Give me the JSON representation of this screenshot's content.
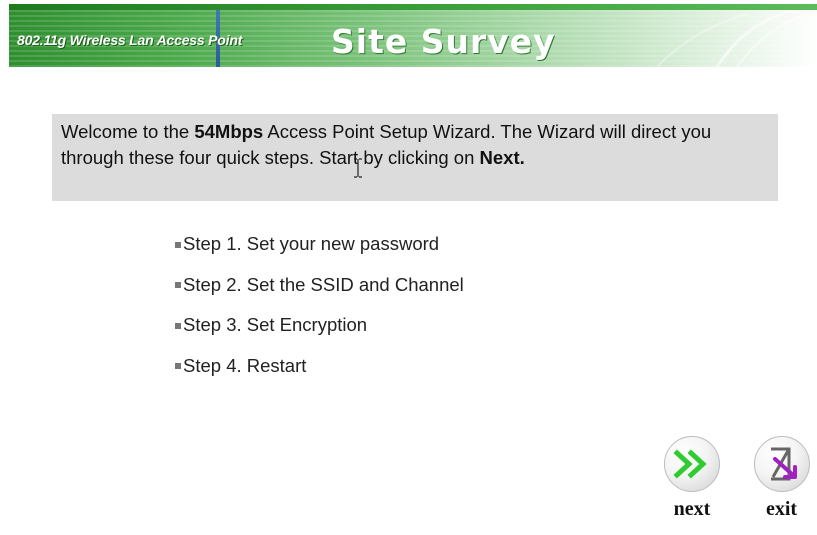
{
  "header": {
    "product_name": "802.11g Wireless Lan Access Point",
    "page_title": "Site Survey"
  },
  "welcome": {
    "text_before_bold": "Welcome to the ",
    "bold_speed": "54Mbps",
    "text_after_bold": " Access Point Setup Wizard. The Wizard will direct you through these four quick steps. Start by clicking on ",
    "bold_next": "Next."
  },
  "steps": [
    {
      "label": "Step 1. Set your new password"
    },
    {
      "label": "Step 2. Set the SSID and Channel"
    },
    {
      "label": "Step 3. Set Encryption"
    },
    {
      "label": "Step 4. Restart"
    }
  ],
  "nav": {
    "next_label": "next",
    "exit_label": "exit"
  },
  "colors": {
    "header_green": "#2f8f2f",
    "welcome_bg": "#dcdcdc",
    "next_arrow": "#2ecc2e",
    "exit_arrow": "#a020c0"
  },
  "icons": {
    "bullet": "square-bullet-icon",
    "next": "double-chevron-right-icon",
    "exit": "exit-arrow-icon",
    "cursor": "text-cursor-icon"
  }
}
